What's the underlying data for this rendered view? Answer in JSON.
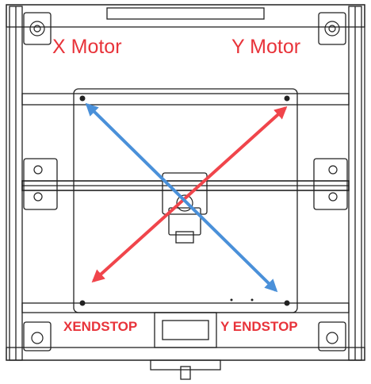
{
  "labels": {
    "x_motor": "X Motor",
    "y_motor": "Y Motor",
    "x_endstop": "XENDSTOP",
    "y_endstop": "Y ENDSTOP"
  },
  "colors": {
    "label_red": "#e8333a",
    "arrow_red": "#f0454b",
    "arrow_blue": "#4a90d9",
    "frame_line": "#222222",
    "background": "#ffffff"
  },
  "arrows": [
    {
      "name": "red-diagonal-arrow",
      "color_key": "arrow_red",
      "direction": "bottom-left to top-right",
      "double_headed": true
    },
    {
      "name": "blue-diagonal-arrow",
      "color_key": "arrow_blue",
      "direction": "top-left to bottom-right",
      "double_headed": true
    }
  ]
}
